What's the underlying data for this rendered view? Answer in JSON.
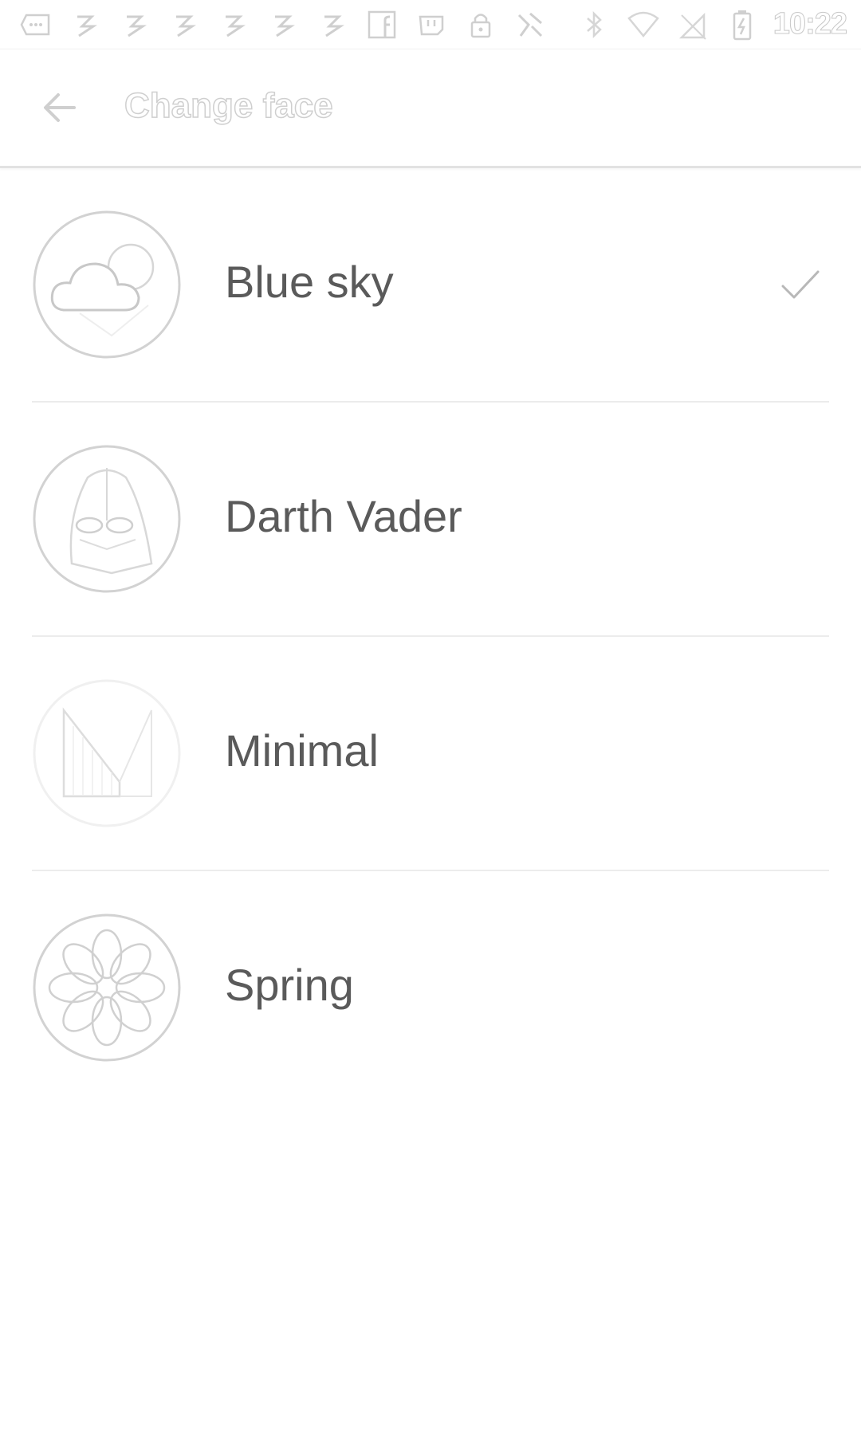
{
  "status_bar": {
    "time": "10:22",
    "notification_icons": [
      "message-bubble-icon",
      "app-icon",
      "app-icon",
      "app-icon",
      "app-icon",
      "app-icon",
      "app-icon",
      "facebook-icon",
      "twitch-icon",
      "lock-icon",
      "app-icon"
    ],
    "system_icons": [
      "bluetooth-icon",
      "wifi-icon",
      "no-sim-icon",
      "battery-charging-icon"
    ]
  },
  "appbar": {
    "title": "Change face",
    "back_icon": "arrow-back-icon"
  },
  "faces": [
    {
      "label": "Blue sky",
      "icon": "cloud-sun-icon",
      "selected": true
    },
    {
      "label": "Darth Vader",
      "icon": "darth-vader-icon",
      "selected": false
    },
    {
      "label": "Minimal",
      "icon": "minimal-m-icon",
      "selected": false
    },
    {
      "label": "Spring",
      "icon": "flower-icon",
      "selected": false
    }
  ],
  "colors": {
    "outline": "#cfcfcf",
    "text": "#5a5a5a",
    "divider": "#ececec"
  }
}
